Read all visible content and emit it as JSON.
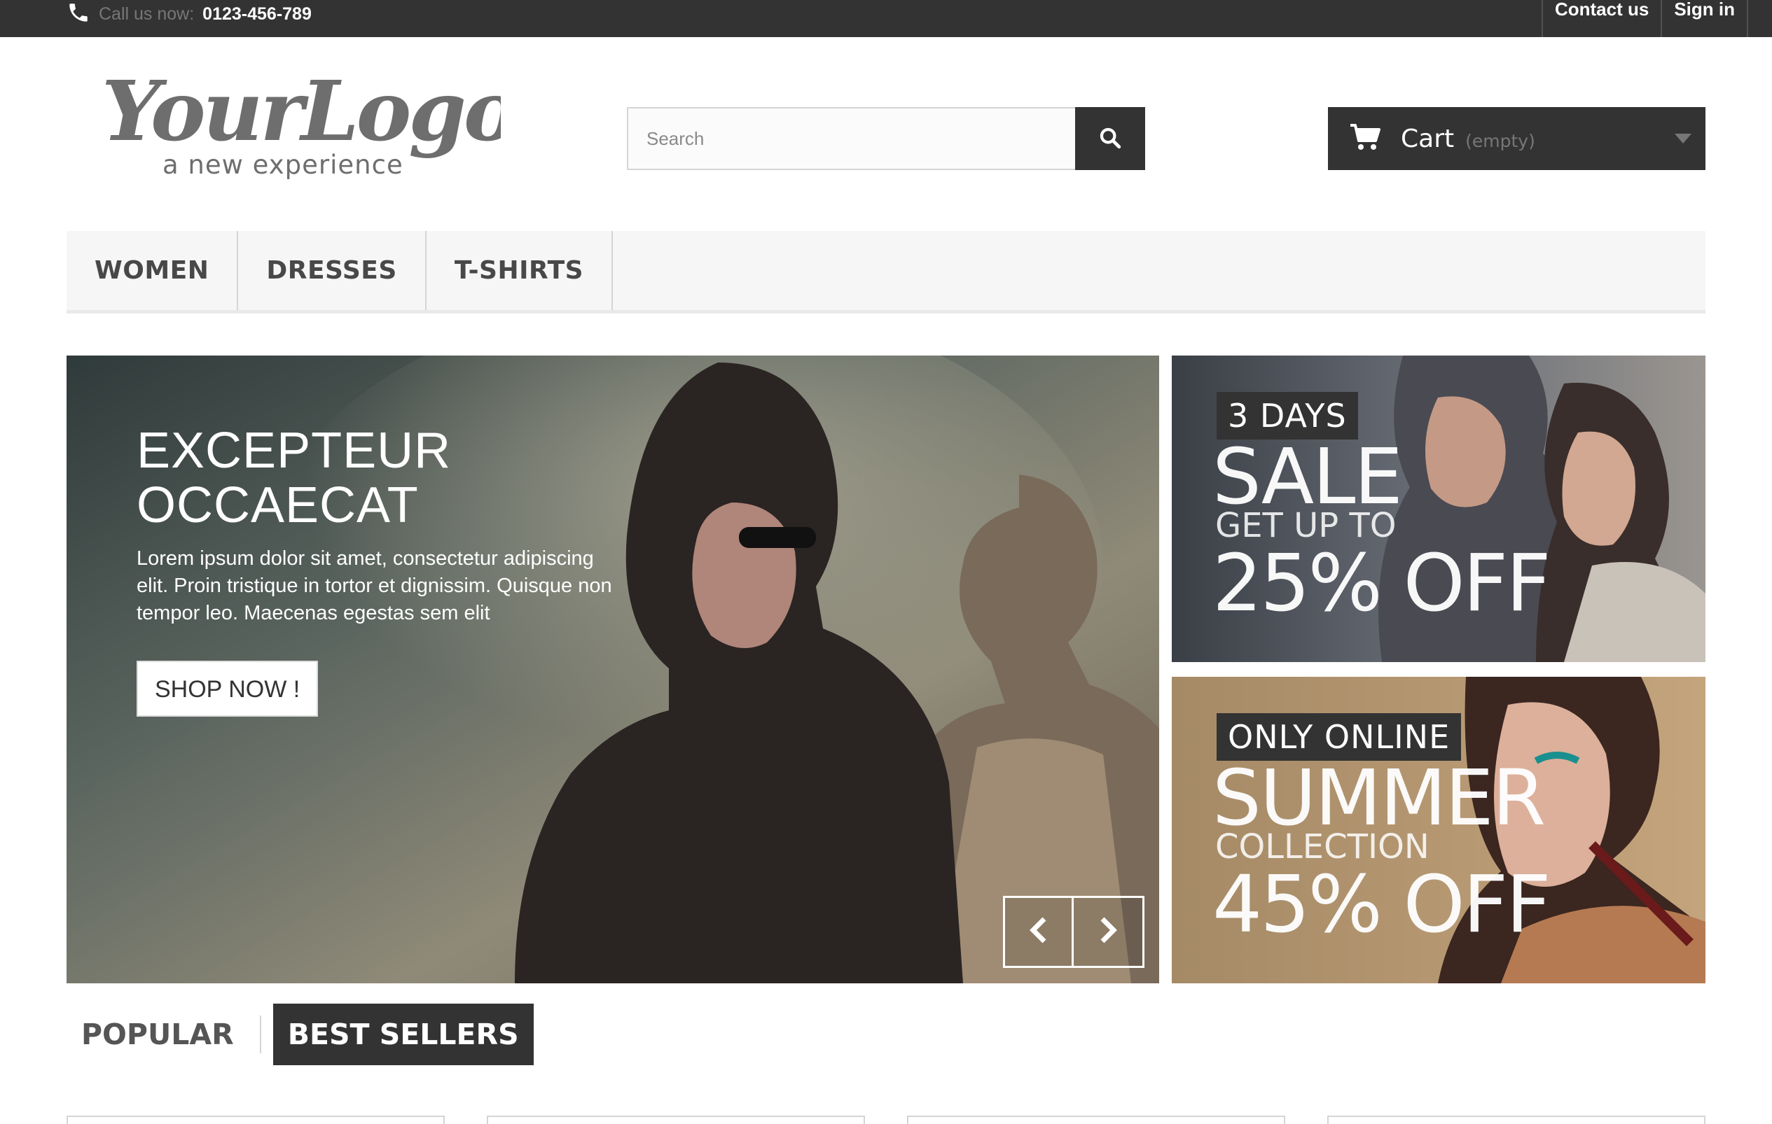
{
  "topbar": {
    "call_label": "Call us now:",
    "phone_number": "0123-456-789",
    "links": [
      "Contact us",
      "Sign in"
    ]
  },
  "logo": {
    "main_text": "YourLogo",
    "tagline": "a new experience"
  },
  "search": {
    "placeholder": "Search",
    "value": ""
  },
  "cart": {
    "label": "Cart",
    "status": "(empty)"
  },
  "nav": {
    "items": [
      "WOMEN",
      "DRESSES",
      "T-SHIRTS"
    ]
  },
  "slider": {
    "title_line1": "EXCEPTEUR",
    "title_line2": "OCCAECAT",
    "text": "Lorem ipsum dolor sit amet, consectetur adipiscing elit. Proin tristique in tortor et dignissim. Quisque non tempor leo. Maecenas egestas sem elit",
    "button": "SHOP NOW !"
  },
  "promos": [
    {
      "tag": "3 DAYS",
      "headline": "SALE",
      "subline": "GET UP TO",
      "discount": "25% OFF"
    },
    {
      "tag": "ONLY ONLINE",
      "headline": "SUMMER",
      "subline": "COLLECTION",
      "discount": "45% OFF"
    }
  ],
  "tabs": {
    "items": [
      "POPULAR",
      "BEST SELLERS"
    ],
    "active": "BEST SELLERS"
  },
  "colors": {
    "dark": "#333333",
    "border": "#d6d4d4",
    "nav_bg": "#f6f6f6"
  }
}
